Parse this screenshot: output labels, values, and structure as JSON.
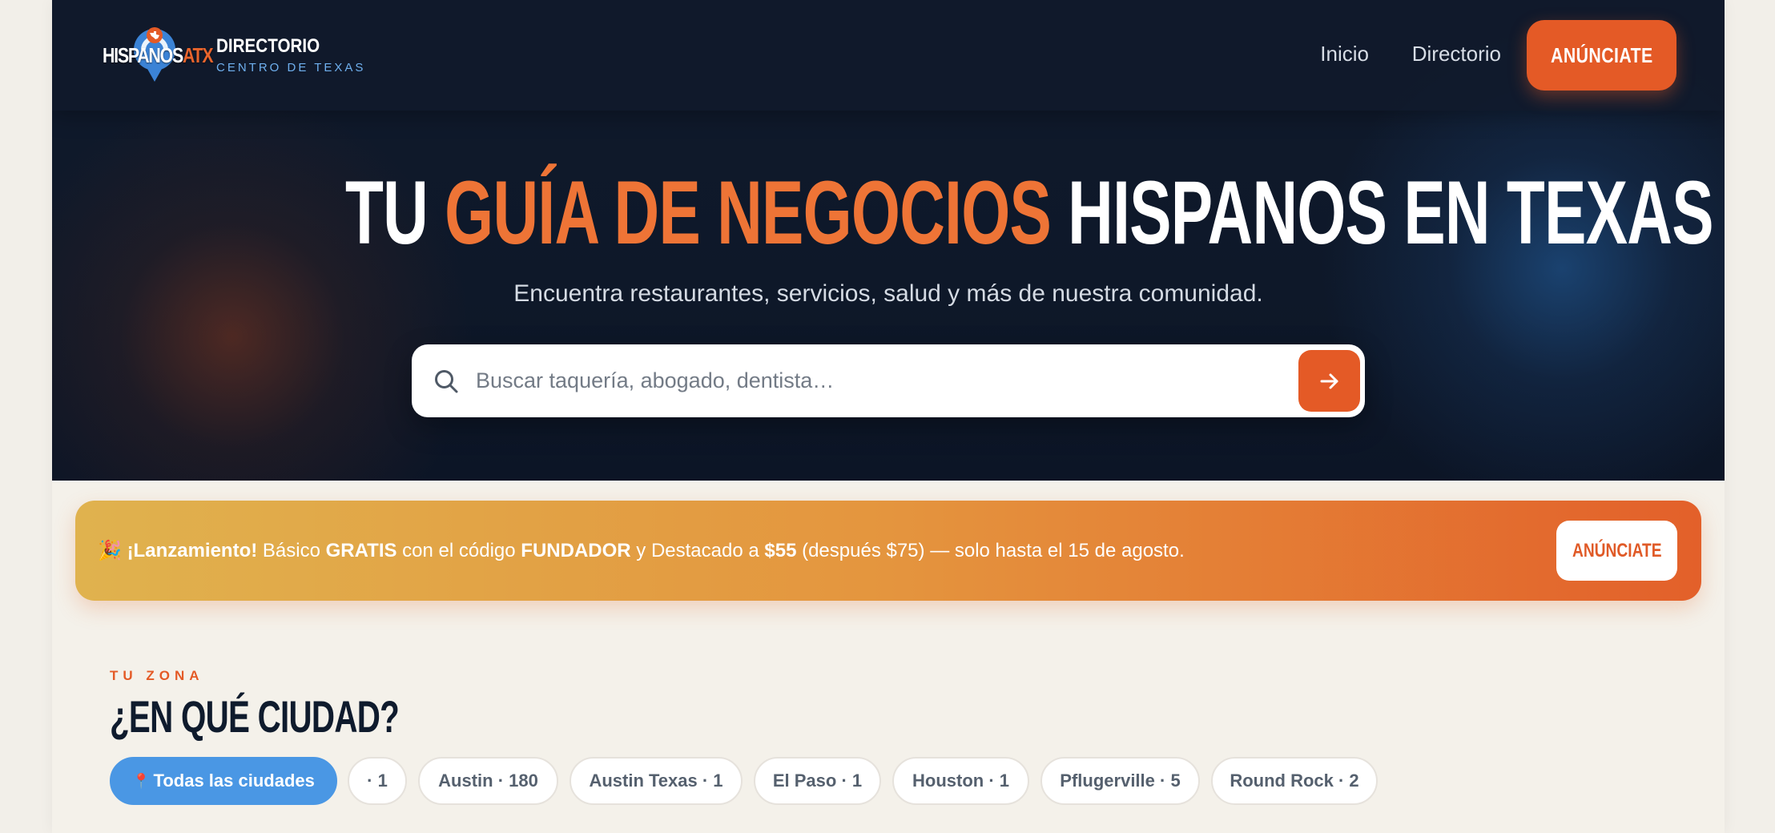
{
  "brand": {
    "logo_text_main": "HISPANOS",
    "logo_text_accent": "ATX",
    "title": "DIRECTORIO",
    "subtitle": "CENTRO DE TEXAS"
  },
  "nav": {
    "items": [
      {
        "label": "Inicio"
      },
      {
        "label": "Directorio"
      }
    ],
    "cta_label": "ANÚNCIATE"
  },
  "hero": {
    "title_part1": "TU ",
    "title_accent": "GUÍA DE NEGOCIOS",
    "title_part2": " HISPANOS EN TEXAS",
    "subtitle": "Encuentra restaurantes, servicios, salud y más de nuestra comunidad.",
    "search_placeholder": "Buscar taquería, abogado, dentista…"
  },
  "promo": {
    "emoji": "🎉",
    "bold1": "¡Lanzamiento!",
    "text1": " Básico ",
    "bold2": "GRATIS",
    "text2": " con el código ",
    "bold3": "FUNDADOR",
    "text3": " y Destacado a ",
    "bold4": "$55",
    "text4": " (después $75) — solo hasta el 15 de agosto.",
    "cta_label": "ANÚNCIATE"
  },
  "zone": {
    "label": "TU ZONA",
    "title": "¿EN QUÉ CIUDAD?",
    "chips": [
      {
        "label": "Todas las ciudades",
        "active": true
      },
      {
        "label": "· 1"
      },
      {
        "label": "Austin · 180"
      },
      {
        "label": "Austin Texas · 1"
      },
      {
        "label": "El Paso · 1"
      },
      {
        "label": "Houston · 1"
      },
      {
        "label": "Pflugerville · 5"
      },
      {
        "label": "Round Rock · 2"
      }
    ]
  },
  "colors": {
    "accent_orange": "#e45a26",
    "navy": "#0f1b2d",
    "chip_active_blue": "#4a97e4"
  }
}
